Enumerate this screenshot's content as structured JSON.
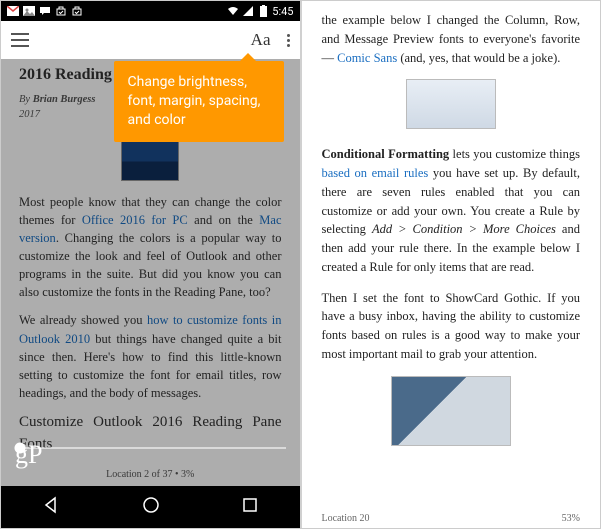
{
  "statusbar": {
    "time": "5:45"
  },
  "appbar": {
    "typography_label": "Aa"
  },
  "tooltip": {
    "text": "Change brightness, font, margin, spacing, and color"
  },
  "left": {
    "title_partial": "2016 Reading Pane Fonts",
    "byline_prefix": "By",
    "author": "Brian Burgess",
    "year": "2017",
    "para1_a": "Most people know that they can change the color themes for ",
    "para1_link1": "Office 2016 for PC",
    "para1_b": " and on the ",
    "para1_link2": "Mac version",
    "para1_c": ". Changing the colors is a popular way to customize the look and feel of Outlook and other programs in the suite. But did you know you can also customize the fonts in the Reading Pane, too?",
    "para2_a": "We already showed you ",
    "para2_link": "how to customize fonts in Outlook 2010",
    "para2_b": " but things have changed quite a bit since then. Here's how to find this little-known setting to customize the font for email titles, row headings, and the body of messages.",
    "subhead": "Customize Outlook 2016 Reading Pane Fonts",
    "logo": "gP",
    "location": "Location 2 of 37 • 3%"
  },
  "right": {
    "para1_a": "the example below I changed the Column, Row, and Message Preview fonts to everyone's favorite — ",
    "para1_link": "Comic Sans",
    "para1_b": " (and, yes, that would be a joke).",
    "para2_bold": "Conditional Formatting",
    "para2_a": " lets you customize things ",
    "para2_link": "based on email rules",
    "para2_b": " you have set up. By default, there are seven rules enabled that you can customize or add your own. You create a Rule by selecting ",
    "para2_i1": "Add > Condition > More Choices",
    "para2_c": " and then add your rule there. In the example below I created a Rule for only items that are read.",
    "para3": "Then I set the font to ShowCard Gothic. If you have a busy inbox, having the ability to customize fonts based on rules is a good way to make your most important mail to grab your attention.",
    "location": "Location 20",
    "percent": "53%"
  }
}
